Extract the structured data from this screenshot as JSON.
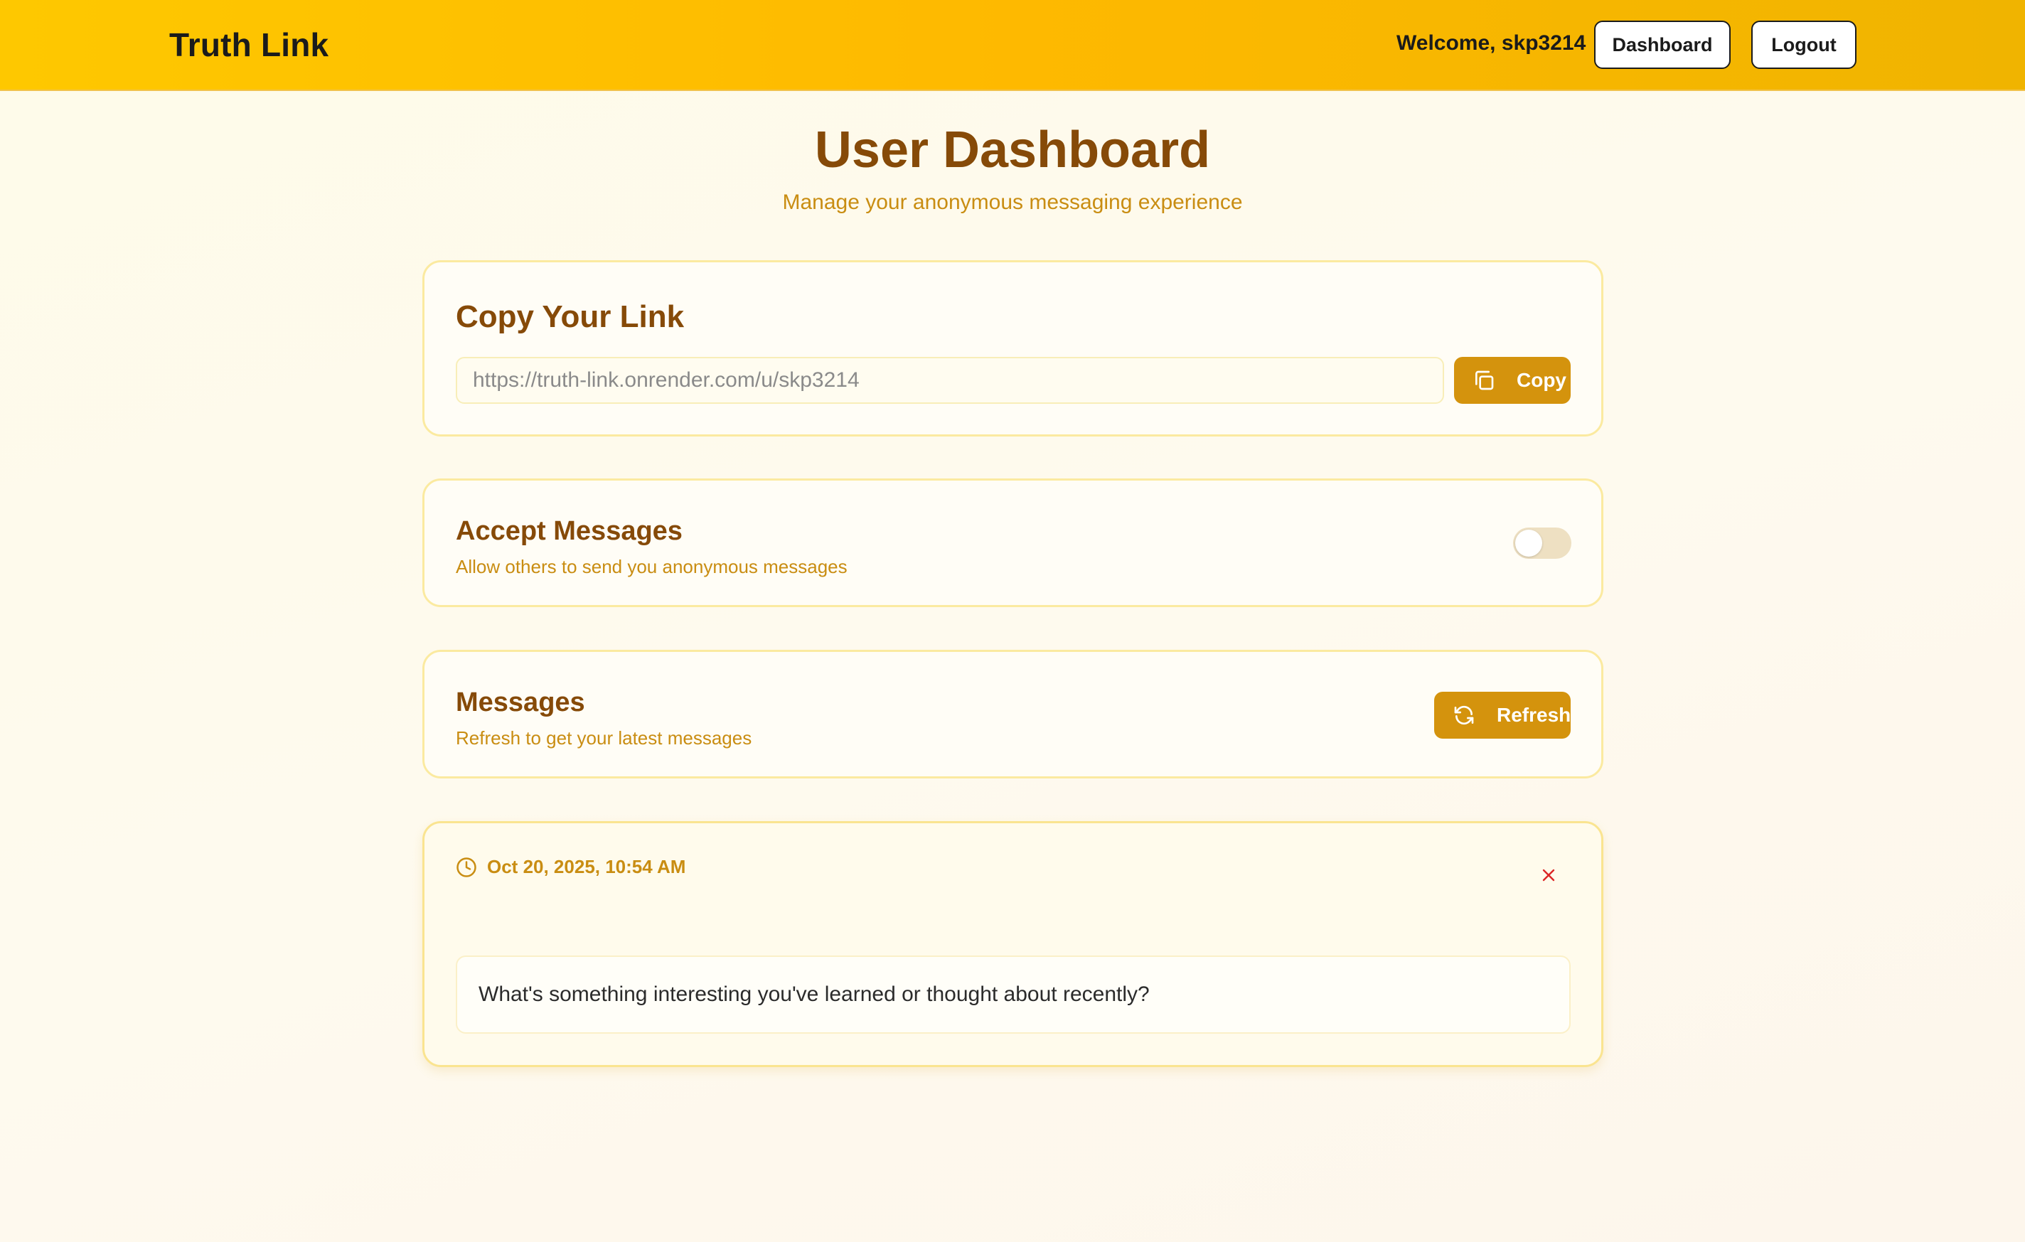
{
  "header": {
    "brand": "Truth Link",
    "welcome": "Welcome, skp3214",
    "dashboard_label": "Dashboard",
    "logout_label": "Logout"
  },
  "page": {
    "title": "User Dashboard",
    "subtitle": "Manage your anonymous messaging experience"
  },
  "link_card": {
    "heading": "Copy Your Link",
    "url": "https://truth-link.onrender.com/u/skp3214",
    "copy_label": "Copy",
    "copy_icon": "copy-icon"
  },
  "accept_card": {
    "title": "Accept Messages",
    "description": "Allow others to send you anonymous messages",
    "enabled": false
  },
  "messages_card": {
    "title": "Messages",
    "description": "Refresh to get your latest messages",
    "refresh_label": "Refresh",
    "refresh_icon": "refresh-icon"
  },
  "messages": [
    {
      "date": "Oct 20, 2025, 10:54 AM",
      "text": "What's something interesting you've learned or thought about recently?",
      "clock_icon": "clock-icon",
      "delete_icon": "close-icon"
    }
  ],
  "colors": {
    "header_gradient_start": "#fec800",
    "header_gradient_end": "#f0b400",
    "title": "#864a08",
    "accent": "#c98d12",
    "button": "#d4930d",
    "delete": "#dc2626"
  }
}
